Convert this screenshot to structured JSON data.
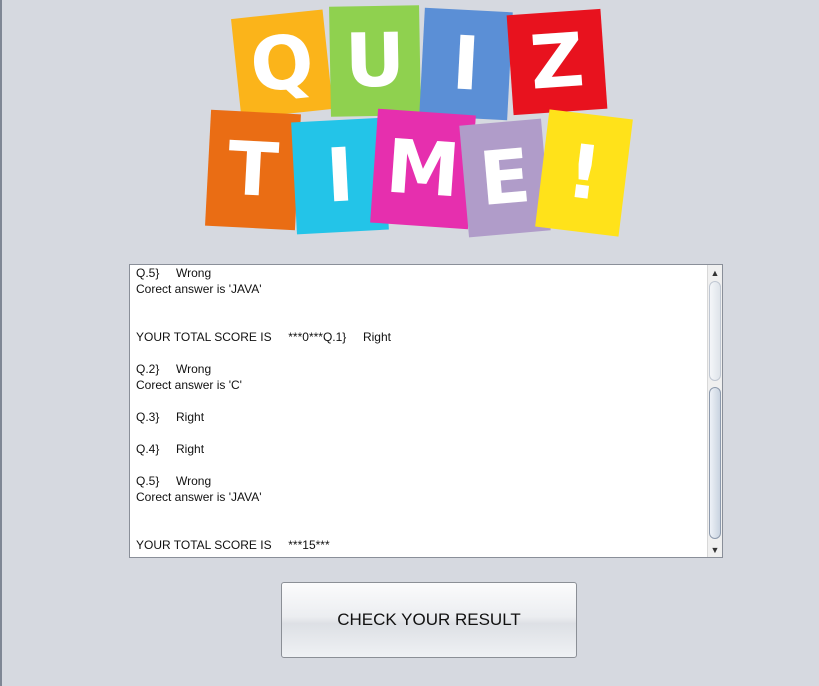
{
  "logo": {
    "row1": [
      {
        "letter": "Q",
        "color": "#fbb41a"
      },
      {
        "letter": "U",
        "color": "#8fd14f"
      },
      {
        "letter": "I",
        "color": "#5b8fd6"
      },
      {
        "letter": "Z",
        "color": "#e8121e"
      }
    ],
    "row2": [
      {
        "letter": "T",
        "color": "#ea6d14"
      },
      {
        "letter": "I",
        "color": "#23c4e8"
      },
      {
        "letter": "M",
        "color": "#e62fae"
      },
      {
        "letter": "E",
        "color": "#b09cc9"
      },
      {
        "letter": "!",
        "color": "#ffe21a"
      }
    ]
  },
  "results": {
    "lines": [
      "Q.5}     Wrong",
      "Corect answer is 'JAVA'",
      "",
      "",
      "YOUR TOTAL SCORE IS     ***0***Q.1}     Right",
      "",
      "Q.2}     Wrong",
      "Corect answer is 'C'",
      "",
      "Q.3}     Right",
      "",
      "Q.4}     Right",
      "",
      "Q.5}     Wrong",
      "Corect answer is 'JAVA'",
      "",
      "",
      "YOUR TOTAL SCORE IS     ***15***"
    ]
  },
  "scrollbar": {
    "up_icon": "arrow-up-icon",
    "down_icon": "arrow-down-icon"
  },
  "button": {
    "label": "CHECK YOUR RESULT"
  }
}
